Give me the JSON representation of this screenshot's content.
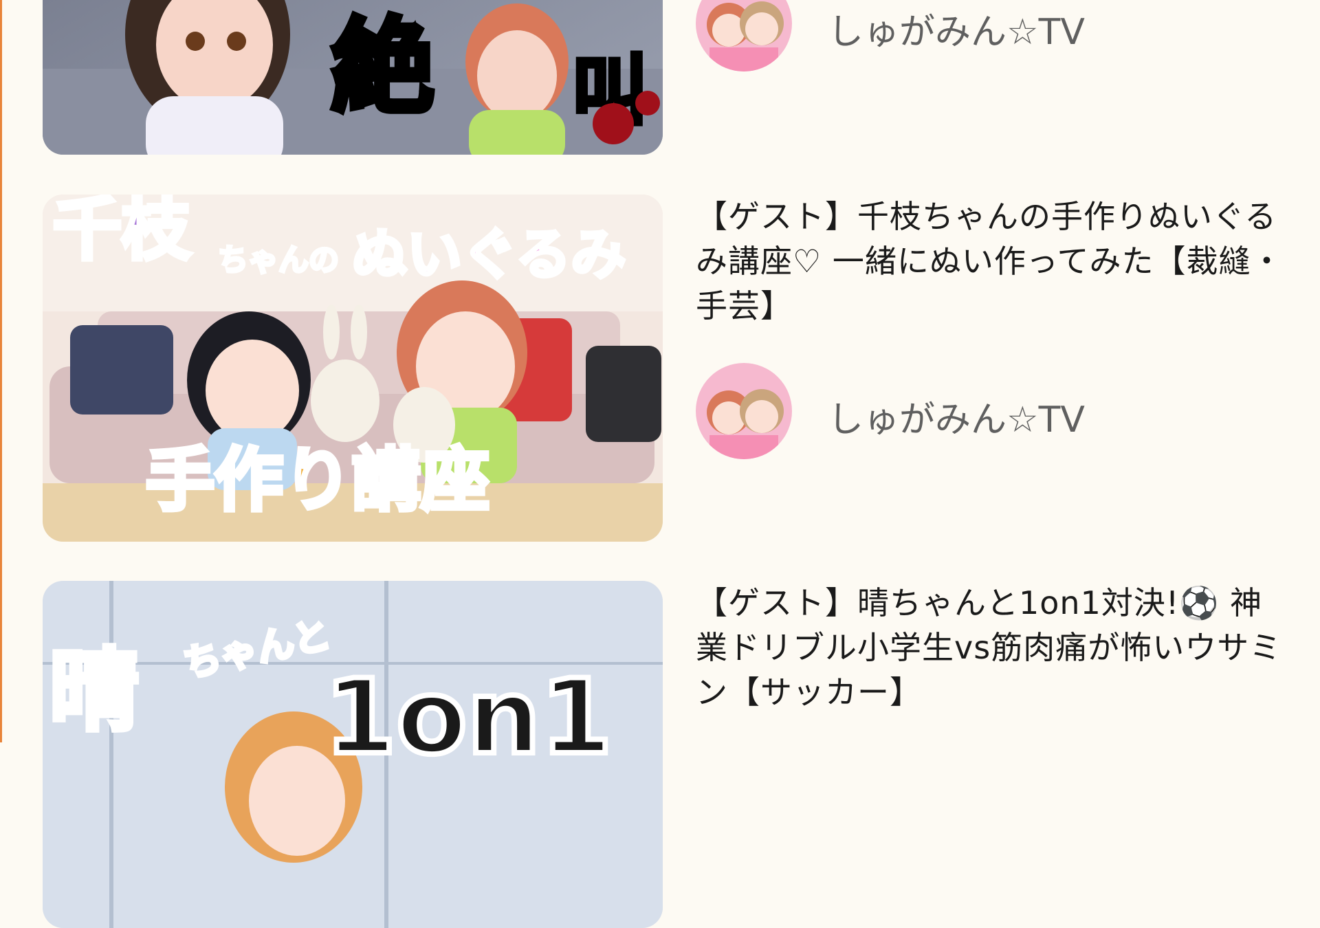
{
  "videos": [
    {
      "title": "",
      "channel": "しゅがみん☆TV",
      "thumbnail_text": [
        "絶",
        "叫"
      ]
    },
    {
      "title": "【ゲスト】千枝ちゃんの手作りぬいぐるみ講座♡ 一緒にぬい作ってみた【裁縫・手芸】",
      "channel": "しゅがみん☆TV",
      "thumbnail_text": [
        "千枝",
        "ちゃんの",
        "ぬいぐるみ",
        "手作り講座"
      ]
    },
    {
      "title": "【ゲスト】晴ちゃんと1on1対決!⚽ 神業ドリブル小学生vs筋肉痛が怖いウサミン【サッカー】",
      "channel": "",
      "thumbnail_text": [
        "晴",
        "ちゃんと",
        "1on1"
      ]
    }
  ],
  "colors": {
    "background": "#fdfaf3",
    "edge_accent": "#e8843a"
  },
  "icons": [
    "channel-avatar"
  ]
}
